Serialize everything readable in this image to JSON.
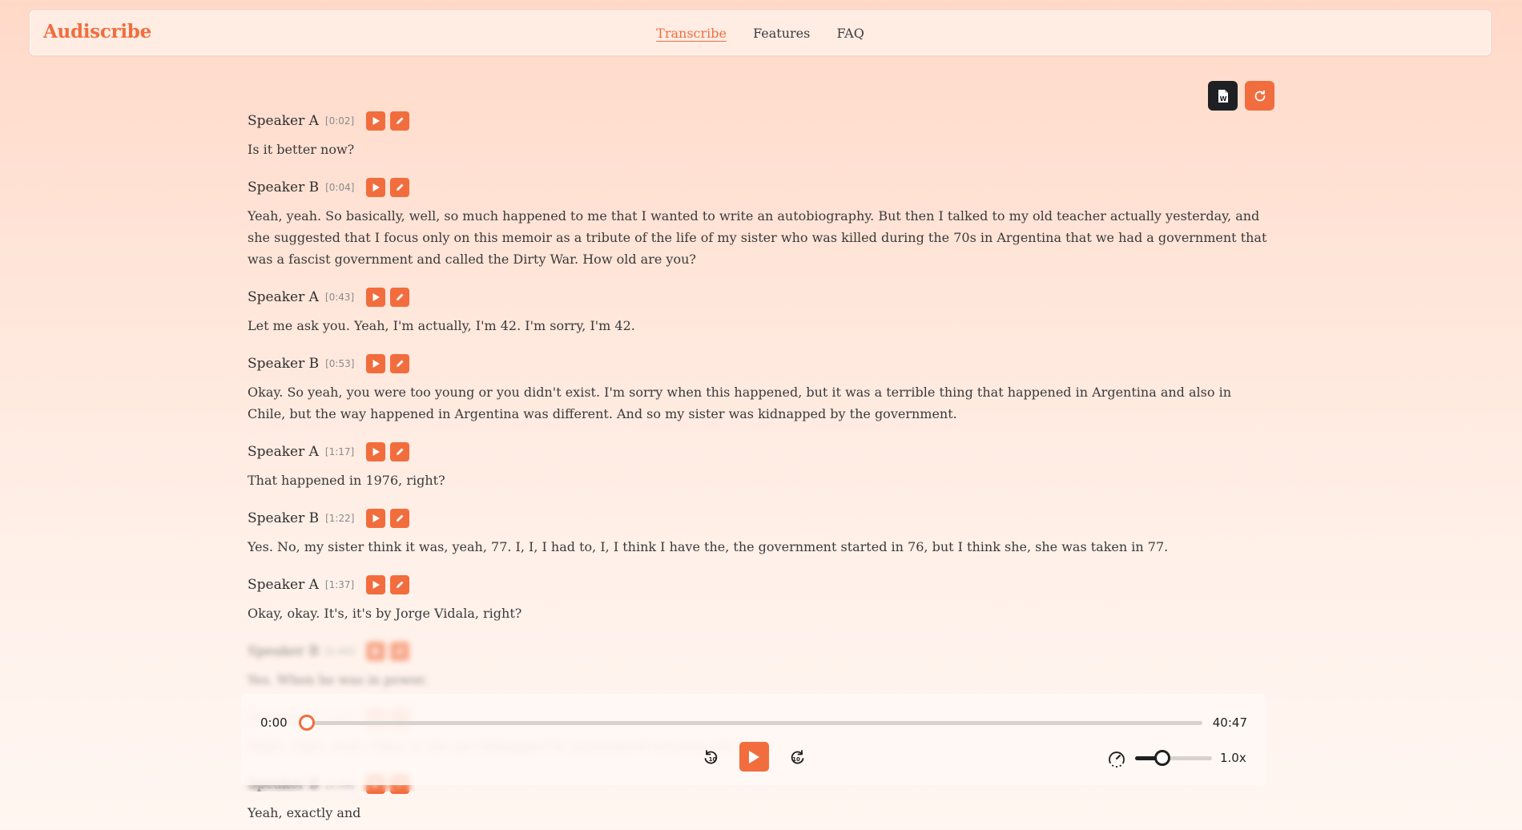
{
  "brand": "Audiscribe",
  "nav": [
    {
      "label": "Transcribe",
      "active": true
    },
    {
      "label": "Features",
      "active": false
    },
    {
      "label": "FAQ",
      "active": false
    }
  ],
  "actions": {
    "doc_icon": "word-doc-icon",
    "refresh_icon": "refresh-icon"
  },
  "transcript": [
    {
      "speaker": "Speaker A",
      "time": "[0:02]",
      "text": "Is it better now?"
    },
    {
      "speaker": "Speaker B",
      "time": "[0:04]",
      "text": "Yeah, yeah. So basically, well, so much happened to me that I wanted to write an autobiography. But then I talked to my old teacher actually yesterday, and she suggested that I focus only on this memoir as a tribute of the life of my sister who was killed during the 70s in Argentina that we had a government that was a fascist government and called the Dirty War. How old are you?"
    },
    {
      "speaker": "Speaker A",
      "time": "[0:43]",
      "text": "Let me ask you. Yeah, I'm actually, I'm 42. I'm sorry, I'm 42."
    },
    {
      "speaker": "Speaker B",
      "time": "[0:53]",
      "text": "Okay. So yeah, you were too young or you didn't exist. I'm sorry when this happened, but it was a terrible thing that happened in Argentina and also in Chile, but the way happened in Argentina was different. And so my sister was kidnapped by the government."
    },
    {
      "speaker": "Speaker A",
      "time": "[1:17]",
      "text": "That happened in 1976, right?"
    },
    {
      "speaker": "Speaker B",
      "time": "[1:22]",
      "text": "Yes. No, my sister think it was, yeah, 77. I, I, I had to, I, I think I have the, the government started in 76, but I think she, she was taken in 77."
    },
    {
      "speaker": "Speaker A",
      "time": "[1:37]",
      "text": "Okay, okay. It's, it's by Jorge Vidala, right?"
    },
    {
      "speaker": "Speaker B",
      "time": "[1:42]",
      "text": "Yes. When he was in power."
    },
    {
      "speaker": "Speaker A",
      "time": "[1:48]",
      "text": "Right, right, yeah. Okay, so she got kidnapped by government because she was"
    },
    {
      "speaker": "Speaker B",
      "time": "[1:54]",
      "text": "Yeah, exactly and"
    }
  ],
  "player": {
    "current": "0:00",
    "total": "40:47",
    "progress": 0,
    "speed": "1.0x",
    "speed_level": 0.35
  }
}
